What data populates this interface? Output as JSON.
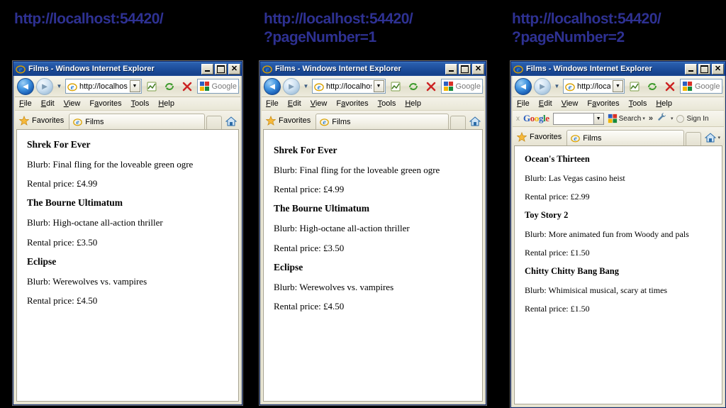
{
  "background_color": "#000000",
  "caption_color": "#2e3192",
  "windows": [
    {
      "caption": "http://localhost:54420/",
      "titlebar": {
        "title": "Films - Windows Internet Explorer",
        "minimize_label": "Minimize",
        "maximize_label": "Maximize",
        "close_label": "Close"
      },
      "toolbar": {
        "back_label": "Back",
        "forward_label": "Forward",
        "history_label": "Recent Pages",
        "address_value": "http://localhost::",
        "address_dropdown_label": "Address dropdown",
        "compatibility_label": "Compatibility View",
        "refresh_label": "Refresh",
        "stop_label": "Stop",
        "search_provider": "Google",
        "search_placeholder": "Google"
      },
      "menu": [
        "File",
        "Edit",
        "View",
        "Favorites",
        "Tools",
        "Help"
      ],
      "google_toolbar": null,
      "favbar": {
        "favorites_label": "Favorites",
        "tab_label": "Films",
        "newtab_label": "New Tab",
        "home_label": "Home",
        "home_has_caret": false
      },
      "films": [
        {
          "title": "Shrek For Ever",
          "blurb": "Blurb: Final fling for the loveable green ogre",
          "price": "Rental price: £4.99"
        },
        {
          "title": "The Bourne Ultimatum",
          "blurb": "Blurb: High-octane all-action thriller",
          "price": "Rental price: £3.50"
        },
        {
          "title": "Eclipse",
          "blurb": "Blurb: Werewolves vs. vampires",
          "price": "Rental price: £4.50"
        }
      ]
    },
    {
      "caption": "http://localhost:54420/\n?pageNumber=1",
      "titlebar": {
        "title": "Films - Windows Internet Explorer",
        "minimize_label": "Minimize",
        "maximize_label": "Maximize",
        "close_label": "Close"
      },
      "toolbar": {
        "back_label": "Back",
        "forward_label": "Forward",
        "history_label": "Recent Pages",
        "address_value": "http://localhost::",
        "address_dropdown_label": "Address dropdown",
        "compatibility_label": "Compatibility View",
        "refresh_label": "Refresh",
        "stop_label": "Stop",
        "search_provider": "Google",
        "search_placeholder": "Google"
      },
      "menu": [
        "File",
        "Edit",
        "View",
        "Favorites",
        "Tools",
        "Help"
      ],
      "google_toolbar": null,
      "favbar": {
        "favorites_label": "Favorites",
        "tab_label": "Films",
        "newtab_label": "New Tab",
        "home_label": "Home",
        "home_has_caret": false
      },
      "films": [
        {
          "title": "Shrek For Ever",
          "blurb": "Blurb: Final fling for the loveable green ogre",
          "price": "Rental price: £4.99"
        },
        {
          "title": "The Bourne Ultimatum",
          "blurb": "Blurb: High-octane all-action thriller",
          "price": "Rental price: £3.50"
        },
        {
          "title": "Eclipse",
          "blurb": "Blurb: Werewolves vs. vampires",
          "price": "Rental price: £4.50"
        }
      ]
    },
    {
      "caption": "http://localhost:54420/\n?pageNumber=2",
      "titlebar": {
        "title": "Films - Windows Internet Explorer",
        "minimize_label": "Minimize",
        "maximize_label": "Maximize",
        "close_label": "Close"
      },
      "toolbar": {
        "back_label": "Back",
        "forward_label": "Forward",
        "history_label": "Recent Pages",
        "address_value": "http://localhost::",
        "address_dropdown_label": "Address dropdown",
        "compatibility_label": "Compatibility View",
        "refresh_label": "Refresh",
        "stop_label": "Stop",
        "search_provider": "Google",
        "search_placeholder": "Google"
      },
      "menu": [
        "File",
        "Edit",
        "View",
        "Favorites",
        "Tools",
        "Help"
      ],
      "google_toolbar": {
        "close_label": "x",
        "logo_text": "Google",
        "search_value": "",
        "search_button_label": "Search",
        "more_label": "»",
        "settings_label": "Settings",
        "signin_label": "Sign In"
      },
      "favbar": {
        "favorites_label": "Favorites",
        "tab_label": "Films",
        "newtab_label": "New Tab",
        "home_label": "Home",
        "home_has_caret": true
      },
      "films": [
        {
          "title": "Ocean's Thirteen",
          "blurb": "Blurb: Las Vegas casino heist",
          "price": "Rental price: £2.99"
        },
        {
          "title": "Toy Story 2",
          "blurb": "Blurb: More animated fun from Woody and pals",
          "price": "Rental price: £1.50"
        },
        {
          "title": "Chitty Chitty Bang Bang",
          "blurb": "Blurb: Whimisical musical, scary at times",
          "price": "Rental price: £1.50"
        }
      ]
    }
  ]
}
